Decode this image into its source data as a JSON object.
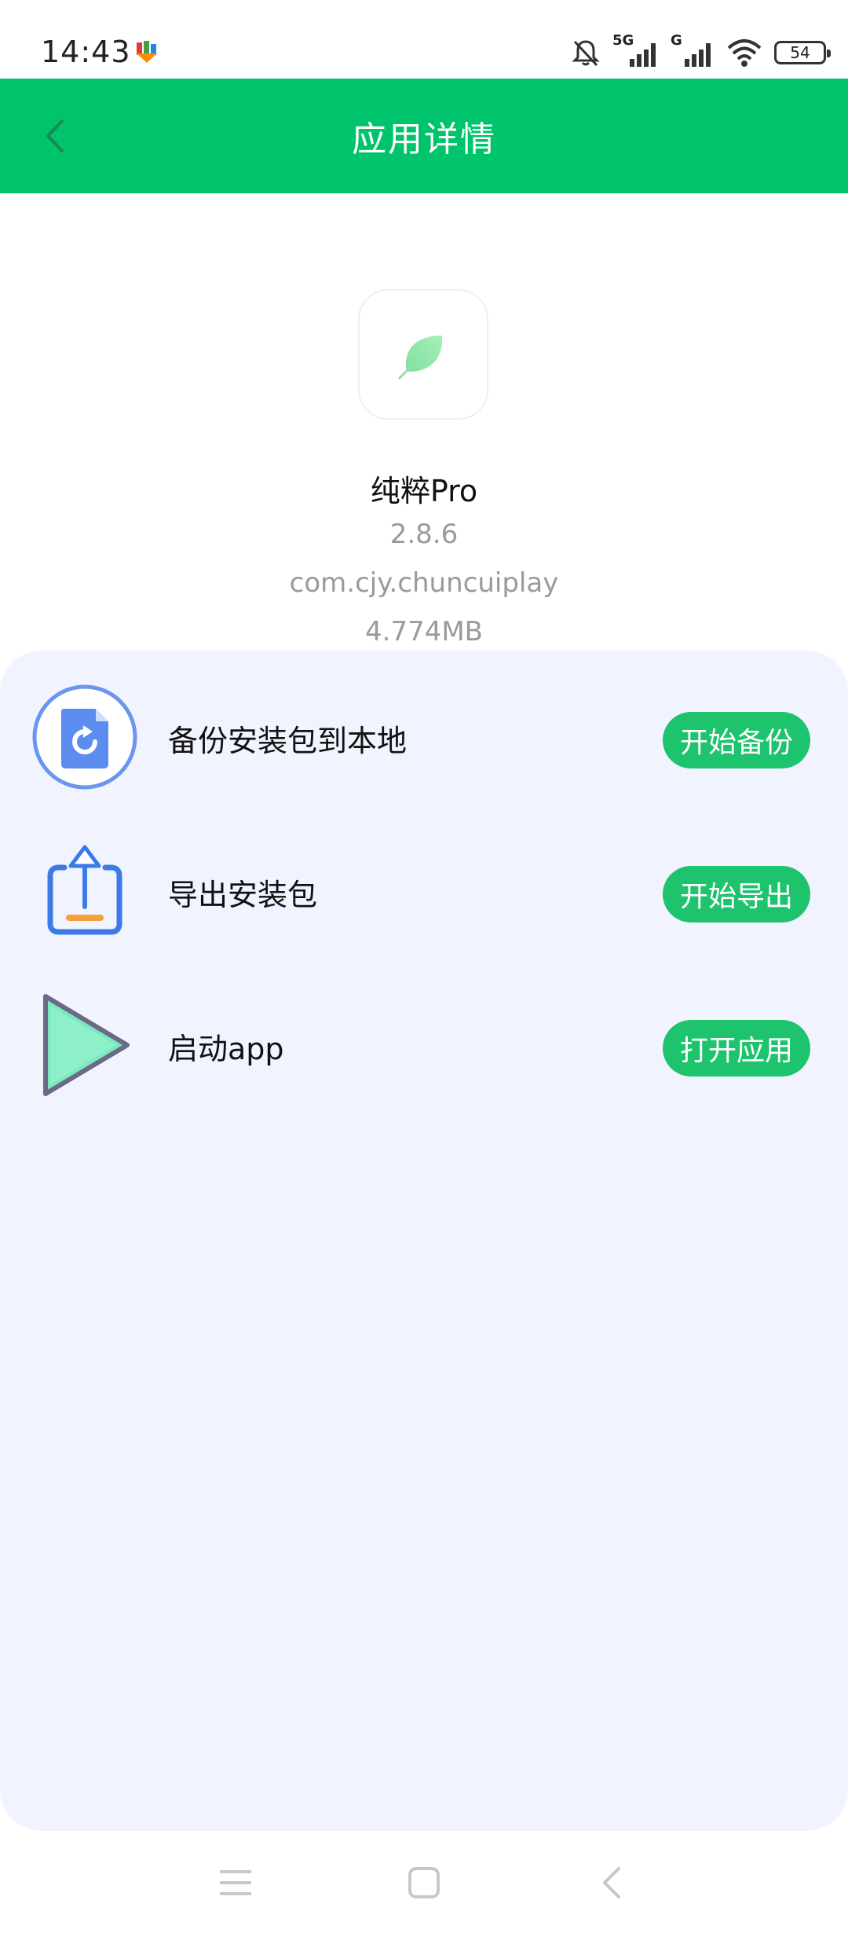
{
  "status_bar": {
    "time": "14:43",
    "battery": "54",
    "network_primary": "5G",
    "network_secondary": "G"
  },
  "header": {
    "title": "应用详情"
  },
  "app_info": {
    "name": "纯粹Pro",
    "version": "2.8.6",
    "package": "com.cjy.chuncuiplay",
    "size": "4.774MB",
    "icon": "leaf-icon"
  },
  "actions": [
    {
      "label": "备份安装包到本地",
      "button": "开始备份",
      "icon": "backup-file-icon"
    },
    {
      "label": "导出安装包",
      "button": "开始导出",
      "icon": "export-upload-icon"
    },
    {
      "label": "启动app",
      "button": "打开应用",
      "icon": "play-triangle-icon"
    }
  ],
  "nav_bar": {
    "items": [
      "menu-icon",
      "home-square-icon",
      "back-chevron-icon"
    ]
  },
  "colors": {
    "header": "#00c46b",
    "button": "#1ec36d",
    "card_bg": "#f1f4fe"
  }
}
